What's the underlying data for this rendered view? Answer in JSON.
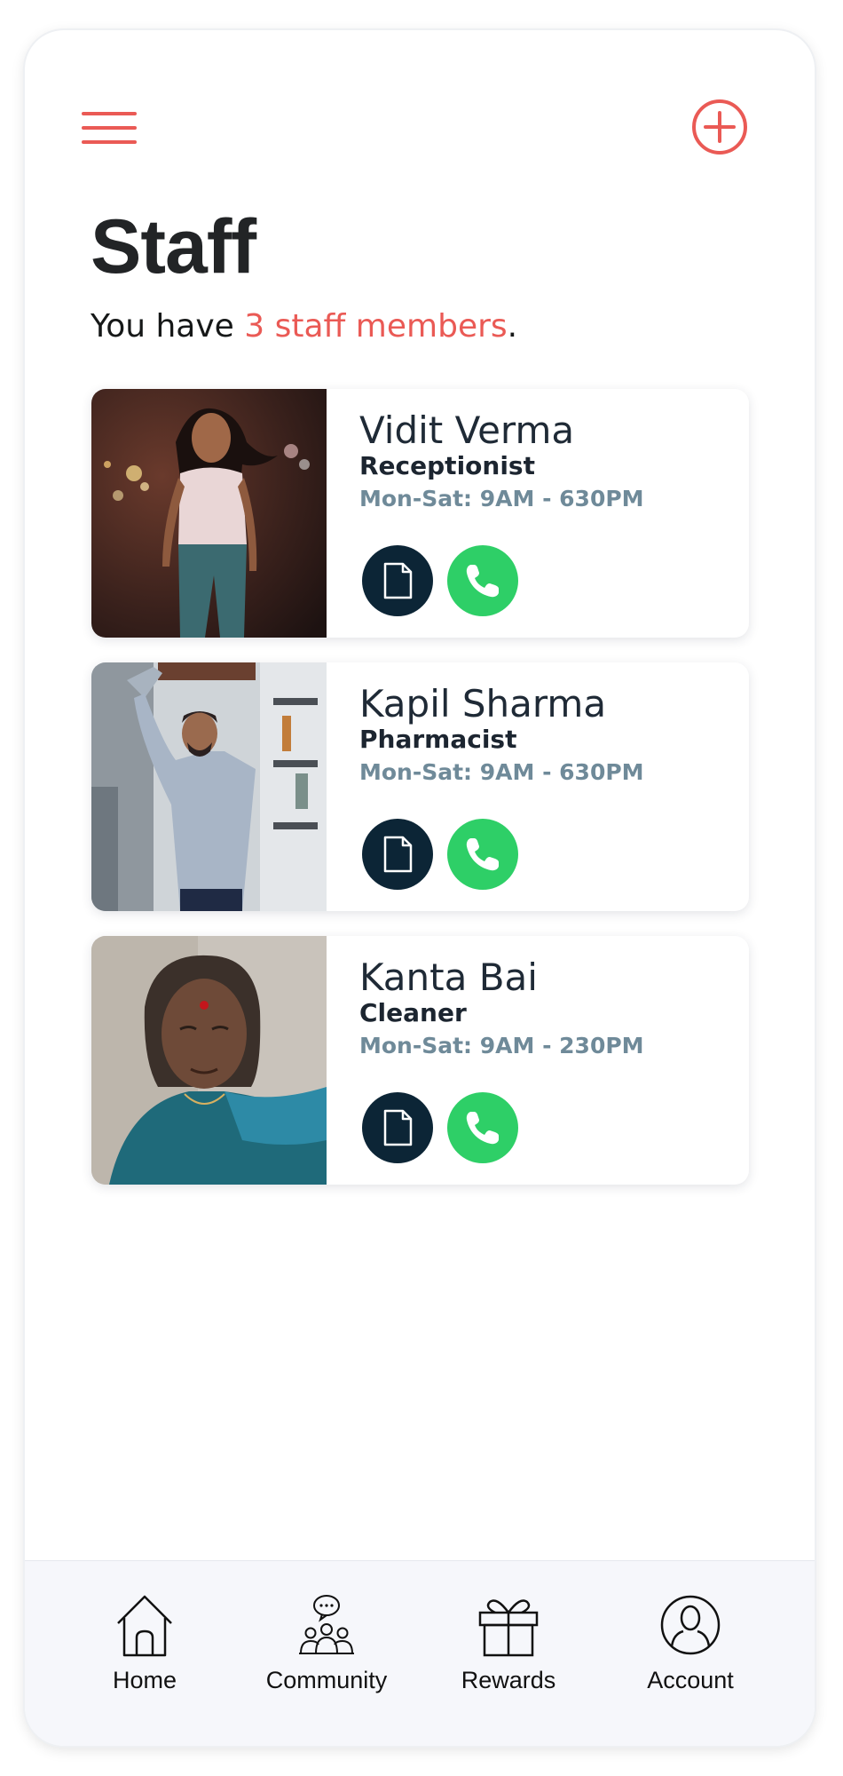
{
  "header": {
    "title": "Staff",
    "subtitle_prefix": "You have ",
    "subtitle_highlight": "3 staff members",
    "subtitle_suffix": ".",
    "menu_icon": "hamburger-menu-icon",
    "add_icon": "plus-circle-icon"
  },
  "colors": {
    "accent": "#ea5a55",
    "doc_button": "#0c2536",
    "call_button": "#2ecf67",
    "hours_text": "#6f8a99"
  },
  "staff": [
    {
      "name": "Vidit Verma",
      "role": "Receptionist",
      "hours": "Mon-Sat: 9AM - 630PM"
    },
    {
      "name": "Kapil Sharma",
      "role": "Pharmacist",
      "hours": "Mon-Sat: 9AM - 630PM"
    },
    {
      "name": "Kanta Bai",
      "role": "Cleaner",
      "hours": "Mon-Sat: 9AM - 230PM"
    }
  ],
  "tabs": [
    {
      "label": "Home",
      "icon": "home-icon"
    },
    {
      "label": "Community",
      "icon": "community-icon"
    },
    {
      "label": "Rewards",
      "icon": "gift-icon"
    },
    {
      "label": "Account",
      "icon": "account-icon"
    }
  ]
}
